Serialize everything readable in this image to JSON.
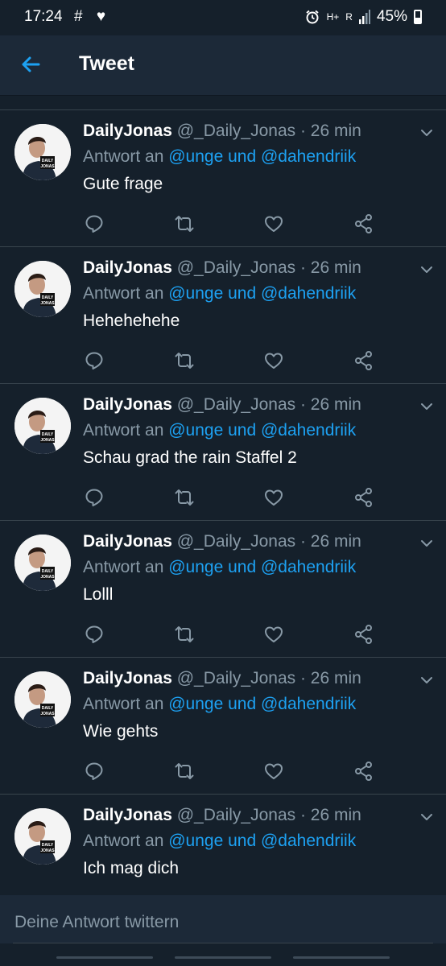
{
  "status_bar": {
    "time": "17:24",
    "notifications": "# ♥",
    "network": "H+",
    "signal_label": "R",
    "battery": "45%"
  },
  "header": {
    "title": "Tweet"
  },
  "tweets": [
    {
      "name": "DailyJonas",
      "handle": "@_Daily_Jonas",
      "separator": " · ",
      "time": "26 min",
      "reply_label": "Antwort an ",
      "mentions": "@unge und @dahendriik",
      "text": "Gute frage"
    },
    {
      "name": "DailyJonas",
      "handle": "@_Daily_Jonas",
      "separator": " · ",
      "time": "26 min",
      "reply_label": "Antwort an ",
      "mentions": "@unge und @dahendriik",
      "text": "Hehehehehe"
    },
    {
      "name": "DailyJonas",
      "handle": "@_Daily_Jonas",
      "separator": " · ",
      "time": "26 min",
      "reply_label": "Antwort an ",
      "mentions": "@unge und @dahendriik",
      "text": "Schau grad the rain Staffel 2"
    },
    {
      "name": "DailyJonas",
      "handle": "@_Daily_Jonas",
      "separator": " · ",
      "time": "26 min",
      "reply_label": "Antwort an ",
      "mentions": "@unge und @dahendriik",
      "text": "Lolll"
    },
    {
      "name": "DailyJonas",
      "handle": "@_Daily_Jonas",
      "separator": " · ",
      "time": "26 min",
      "reply_label": "Antwort an ",
      "mentions": "@unge und @dahendriik",
      "text": "Wie gehts"
    },
    {
      "name": "DailyJonas",
      "handle": "@_Daily_Jonas",
      "separator": " · ",
      "time": "26 min",
      "reply_label": "Antwort an ",
      "mentions": "@unge und @dahendriik",
      "text": "Ich mag dich"
    }
  ],
  "avatar_logo": "DAILY JONAS",
  "icons": {
    "back": "arrow-left-icon",
    "more": "chevron-down-icon",
    "reply": "reply-icon",
    "retweet": "retweet-icon",
    "like": "heart-icon",
    "share": "share-icon"
  },
  "composer": {
    "placeholder": "Deine Antwort twittern"
  },
  "colors": {
    "background": "#15202b",
    "header": "#1c2938",
    "accent": "#1da1f2",
    "secondary_text": "#8899a6",
    "divider": "#38444d"
  }
}
